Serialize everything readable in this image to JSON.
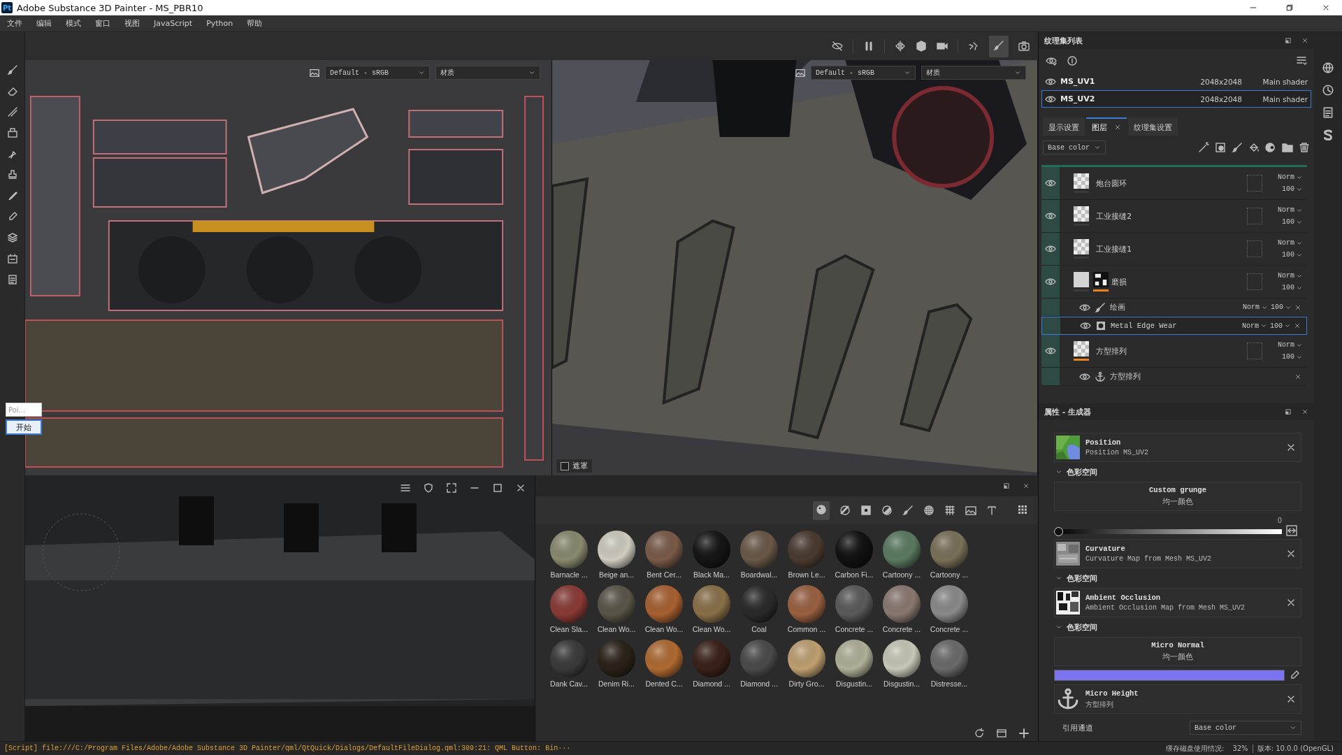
{
  "window": {
    "app_icon": "Pt",
    "title": "Adobe Substance 3D Painter - MS_PBR10"
  },
  "menu": [
    "文件",
    "编辑",
    "模式",
    "窗口",
    "视图",
    "JavaScript",
    "Python",
    "帮助"
  ],
  "viewport_2d": {
    "color_profile": "Default - sRGB",
    "channel": "材质"
  },
  "viewport_3d": {
    "color_profile": "Default - sRGB",
    "channel": "材质",
    "mask_toggle": {
      "label": "遮罩",
      "checked": false
    }
  },
  "popup": {
    "placeholder": "Poi...",
    "button": "开始"
  },
  "texture_sets": {
    "title": "纹理集列表",
    "items": [
      {
        "name": "MS_UV1",
        "resolution": "2048x2048",
        "shader": "Main shader",
        "selected": false
      },
      {
        "name": "MS_UV2",
        "resolution": "2048x2048",
        "shader": "Main shader",
        "selected": true
      }
    ]
  },
  "layers_panel": {
    "tabs": [
      {
        "label": "显示设置",
        "selected": false,
        "closable": false
      },
      {
        "label": "图层",
        "selected": true,
        "closable": true
      },
      {
        "label": "纹理集设置",
        "selected": false,
        "closable": false
      }
    ],
    "channel": "Base color",
    "layers": [
      {
        "name": "炮台圆环",
        "kind": "checker",
        "mask": false,
        "tagged": false,
        "blend": "Norm",
        "opacity": "100"
      },
      {
        "name": "工业接缝2",
        "kind": "checker",
        "mask": false,
        "tagged": false,
        "blend": "Norm",
        "opacity": "100"
      },
      {
        "name": "工业接缝1",
        "kind": "checker",
        "mask": false,
        "tagged": false,
        "blend": "Norm",
        "opacity": "100"
      },
      {
        "name": "磨损",
        "kind": "solid",
        "mask": true,
        "tagged": false,
        "blend": "Norm",
        "opacity": "100",
        "effects": [
          {
            "kind": "paint",
            "name": "绘画",
            "blend": "Norm",
            "opacity": "100",
            "selected": false
          },
          {
            "kind": "fill",
            "name": "Metal Edge Wear",
            "blend": "Norm",
            "opacity": "100",
            "selected": true
          }
        ]
      },
      {
        "name": "方型排列",
        "kind": "checker",
        "mask": false,
        "tagged": true,
        "blend": "Norm",
        "opacity": "100",
        "effects": [
          {
            "kind": "anchor",
            "name": "方型排列",
            "selected": false
          }
        ]
      }
    ]
  },
  "properties": {
    "title": "属性 - 生成器",
    "items": [
      {
        "kind": "position",
        "title": "Position",
        "subtitle": "Position MS_UV2"
      },
      {
        "kind": "section",
        "label": "色彩空间"
      },
      {
        "kind": "uniform",
        "title": "Custom grunge",
        "subtitle": "均一颜色"
      },
      {
        "kind": "slider",
        "reading": "0",
        "level": 0
      },
      {
        "kind": "curvature",
        "title": "Curvature",
        "subtitle": "Curvature Map from Mesh MS_UV2"
      },
      {
        "kind": "section",
        "label": "色彩空间"
      },
      {
        "kind": "occlusion",
        "title": "Ambient Occlusion",
        "subtitle": "Ambient Occlusion Map from Mesh MS_UV2"
      },
      {
        "kind": "section",
        "label": "色彩空间"
      },
      {
        "kind": "uniform",
        "title": "Micro Normal",
        "subtitle": "均一颜色"
      },
      {
        "kind": "swatch",
        "color": "#7b73f0"
      },
      {
        "kind": "anchor",
        "title": "Micro Height",
        "subtitle": "方型排列"
      }
    ],
    "reference_channel": {
      "label": "引用通道",
      "value": "Base color"
    }
  },
  "shelf": {
    "materials": [
      {
        "name": "Barnacle ...",
        "color": "#8a8a70"
      },
      {
        "name": "Beige an...",
        "color": "#d0ccc0"
      },
      {
        "name": "Bent Cer...",
        "color": "#7a5a48"
      },
      {
        "name": "Black Ma...",
        "color": "#151515"
      },
      {
        "name": "Boardwal...",
        "color": "#6a5848"
      },
      {
        "name": "Brown Le...",
        "color": "#4a3a30"
      },
      {
        "name": "Carbon Fi...",
        "color": "#111111"
      },
      {
        "name": "Cartoony ...",
        "color": "#5a7a60"
      },
      {
        "name": "Cartoony ...",
        "color": "#7a7058"
      },
      {
        "name": "Clean Sla...",
        "color": "#8a3a35"
      },
      {
        "name": "Clean Wo...",
        "color": "#5a5548"
      },
      {
        "name": "Clean Wo...",
        "color": "#a86030"
      },
      {
        "name": "Clean Wo...",
        "color": "#8a7048"
      },
      {
        "name": "Coal",
        "color": "#2a2a2a"
      },
      {
        "name": "Common ...",
        "color": "#9a6040"
      },
      {
        "name": "Concrete ...",
        "color": "#5a5a5a"
      },
      {
        "name": "Concrete ...",
        "color": "#8a7870"
      },
      {
        "name": "Concrete ...",
        "color": "#8a8a8a"
      },
      {
        "name": "Dank Cav...",
        "color": "#3a3a3a"
      },
      {
        "name": "Denim Ri...",
        "color": "#2a2218"
      },
      {
        "name": "Dented C...",
        "color": "#b06a30"
      },
      {
        "name": "Diamond ...",
        "color": "#3a2018"
      },
      {
        "name": "Diamond ...",
        "color": "#4a4a4a"
      },
      {
        "name": "Dirty Gro...",
        "color": "#c0a070"
      },
      {
        "name": "Disgustin...",
        "color": "#b0b098"
      },
      {
        "name": "Disgustin...",
        "color": "#c8c8b8"
      },
      {
        "name": "Distresse...",
        "color": "#6a6a6a"
      }
    ]
  },
  "status_bar": {
    "message": "[Script] file:///C:/Program Files/Adobe/Adobe Substance 3D Painter/qml/QtQuick/Dialogs/DefaultFileDialog.qml:309:21: QML Button: Bin···",
    "cache_label": "缓存磁盘使用情况:",
    "cache_value": "32%",
    "version": "版本: 10.0.0 (OpenGL)"
  }
}
